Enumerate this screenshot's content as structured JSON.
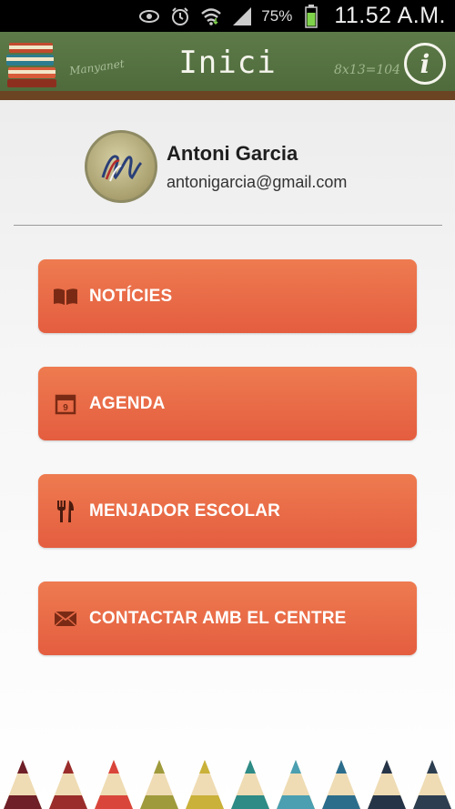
{
  "status_bar": {
    "battery_percent": "75%",
    "time": "11.52 A.M.",
    "icons": [
      "eye-icon",
      "alarm-icon",
      "wifi-icon",
      "signal-icon",
      "battery-icon"
    ]
  },
  "header": {
    "title": "Inici",
    "chalk_text_left": "Manyanet",
    "chalk_text_right": "8x13=104",
    "info_label": "i"
  },
  "profile": {
    "name": "Antoni Garcia",
    "email": "antonigarcia@gmail.com"
  },
  "menu": [
    {
      "label": "NOTÍCIES",
      "icon": "book-icon"
    },
    {
      "label": "AGENDA",
      "icon": "calendar-icon",
      "calendar_day": "9"
    },
    {
      "label": "MENJADOR ESCOLAR",
      "icon": "fork-knife-icon"
    },
    {
      "label": "CONTACTAR AMB EL CENTRE",
      "icon": "envelope-icon"
    }
  ],
  "colors": {
    "button": "#e86a47",
    "chalkboard": "#56733f",
    "wood": "#6b4423",
    "icon": "#7a2a14"
  },
  "pencil_colors": [
    "#6e1f27",
    "#9a2d2b",
    "#d9453a",
    "#9f9a3c",
    "#c9b13a",
    "#2e8b86",
    "#4b9fb0",
    "#2c6d8c",
    "#263447",
    "#2c3e50"
  ]
}
